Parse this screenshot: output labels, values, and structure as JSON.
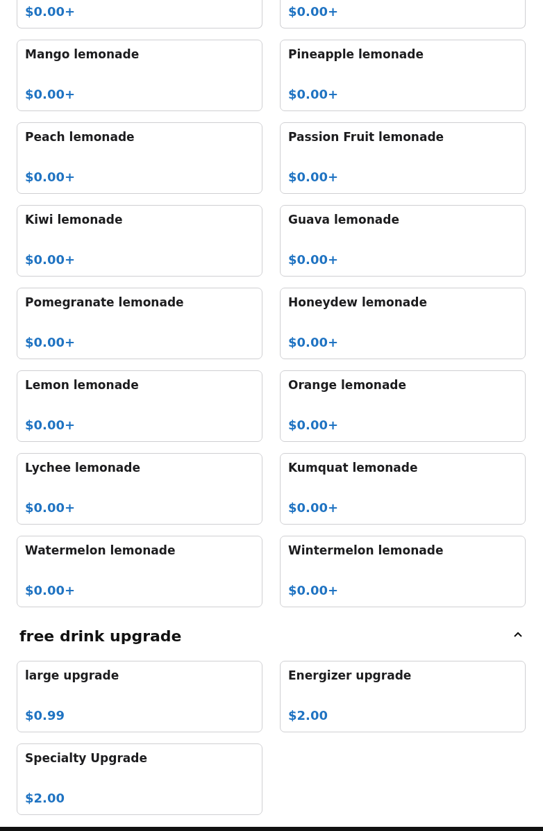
{
  "sections": [
    {
      "items": [
        {
          "kind": "cut",
          "price": "$0.00+"
        },
        {
          "kind": "cut",
          "price": "$0.00+"
        },
        {
          "kind": "full",
          "name": "Mango lemonade",
          "price": "$0.00+"
        },
        {
          "kind": "full",
          "name": "Pineapple lemonade",
          "price": "$0.00+"
        },
        {
          "kind": "full",
          "name": "Peach lemonade",
          "price": "$0.00+"
        },
        {
          "kind": "full",
          "name": "Passion Fruit lemonade",
          "price": "$0.00+"
        },
        {
          "kind": "full",
          "name": "Kiwi lemonade",
          "price": "$0.00+"
        },
        {
          "kind": "full",
          "name": "Guava lemonade",
          "price": "$0.00+"
        },
        {
          "kind": "full",
          "name": "Pomegranate lemonade",
          "price": "$0.00+"
        },
        {
          "kind": "full",
          "name": "Honeydew lemonade",
          "price": "$0.00+"
        },
        {
          "kind": "full",
          "name": "Lemon lemonade",
          "price": "$0.00+"
        },
        {
          "kind": "full",
          "name": "Orange lemonade",
          "price": "$0.00+"
        },
        {
          "kind": "full",
          "name": "Lychee lemonade",
          "price": "$0.00+"
        },
        {
          "kind": "full",
          "name": "Kumquat lemonade",
          "price": "$0.00+"
        },
        {
          "kind": "full",
          "name": "Watermelon lemonade",
          "price": "$0.00+"
        },
        {
          "kind": "full",
          "name": "Wintermelon lemonade",
          "price": "$0.00+"
        }
      ]
    },
    {
      "title": "free drink upgrade",
      "expanded": true,
      "items": [
        {
          "kind": "full",
          "name": "large upgrade",
          "price": "$0.99"
        },
        {
          "kind": "full",
          "name": "Energizer upgrade",
          "price": "$2.00"
        },
        {
          "kind": "full",
          "name": "Specialty Upgrade",
          "price": "$2.00"
        }
      ]
    }
  ]
}
